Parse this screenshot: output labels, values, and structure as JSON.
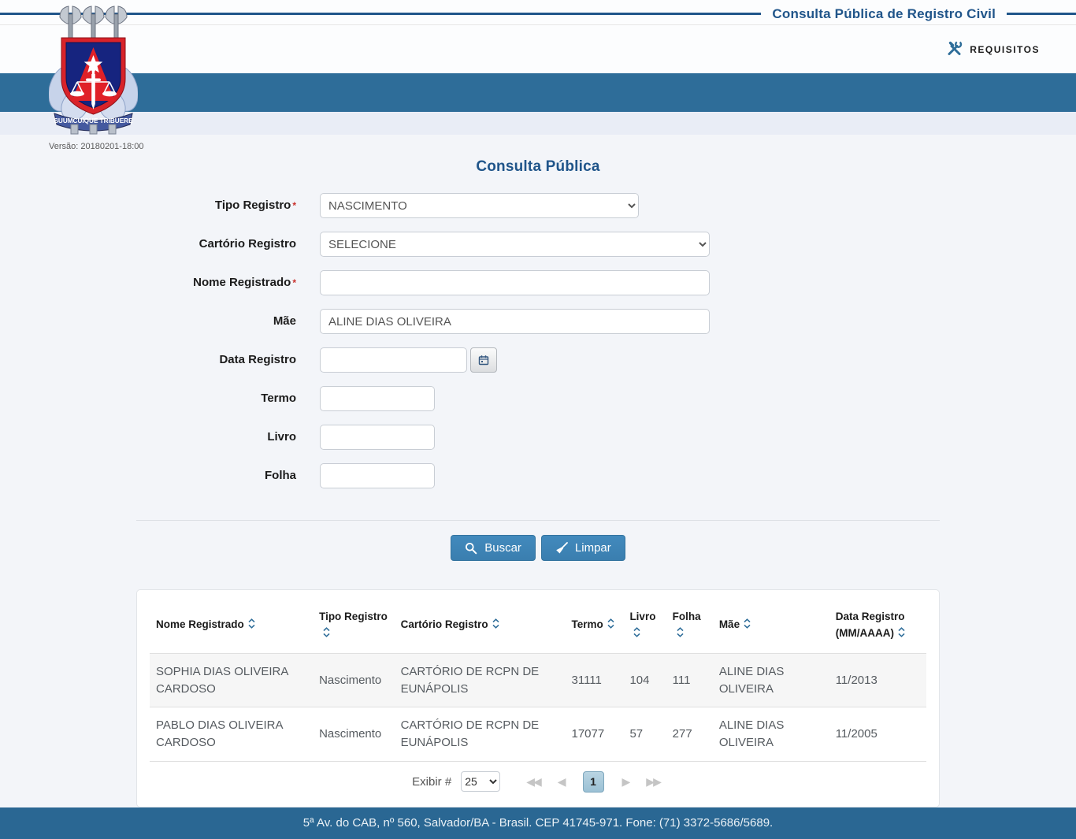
{
  "header": {
    "title": "Consulta Pública de Registro Civil",
    "requisitos_label": "REQUISITOS"
  },
  "logo": {
    "motto": "SUUMCUIQUE TRIBUERE",
    "version": "Versão: 20180201-18:00"
  },
  "form": {
    "title": "Consulta Pública",
    "required_marker": "*",
    "fields": {
      "tipo_registro": {
        "label": "Tipo Registro",
        "value": "NASCIMENTO"
      },
      "cartorio_registro": {
        "label": "Cartório Registro",
        "value": "SELECIONE"
      },
      "nome_registrado": {
        "label": "Nome Registrado",
        "value": ""
      },
      "mae": {
        "label": "Mãe",
        "value": "ALINE DIAS OLIVEIRA"
      },
      "data_registro": {
        "label": "Data Registro",
        "value": ""
      },
      "termo": {
        "label": "Termo",
        "value": ""
      },
      "livro": {
        "label": "Livro",
        "value": ""
      },
      "folha": {
        "label": "Folha",
        "value": ""
      }
    },
    "buttons": {
      "buscar": "Buscar",
      "limpar": "Limpar"
    }
  },
  "table": {
    "headers": [
      {
        "label": "Nome Registrado"
      },
      {
        "label": "Tipo Registro"
      },
      {
        "label": "Cartório Registro"
      },
      {
        "label": "Termo"
      },
      {
        "label": "Livro"
      },
      {
        "label": "Folha"
      },
      {
        "label": "Mãe"
      },
      {
        "label": "Data Registro",
        "label2": "(MM/AAAA)"
      }
    ],
    "rows": [
      {
        "nome": "SOPHIA DIAS OLIVEIRA CARDOSO",
        "tipo": "Nascimento",
        "cartorio": "CARTÓRIO DE RCPN DE EUNÁPOLIS",
        "termo": "31111",
        "livro": "104",
        "folha": "111",
        "mae": "ALINE DIAS OLIVEIRA",
        "data": "11/2013"
      },
      {
        "nome": "PABLO DIAS OLIVEIRA CARDOSO",
        "tipo": "Nascimento",
        "cartorio": "CARTÓRIO DE RCPN DE EUNÁPOLIS",
        "termo": "17077",
        "livro": "57",
        "folha": "277",
        "mae": "ALINE DIAS OLIVEIRA",
        "data": "11/2005"
      }
    ]
  },
  "pagination": {
    "exibir_label": "Exibir #",
    "page_size": "25",
    "current_page": "1",
    "first": "◀◀",
    "prev": "◀",
    "next": "▶",
    "last": "▶▶"
  },
  "footer": {
    "address": "5ª Av. do CAB, nº 560, Salvador/BA - Brasil. CEP 41745-971. Fone: (71) 3372-5686/5689."
  },
  "colors": {
    "accent_blue": "#2e6d99",
    "title_blue": "#20558a",
    "button_blue": "#3d85b8"
  }
}
